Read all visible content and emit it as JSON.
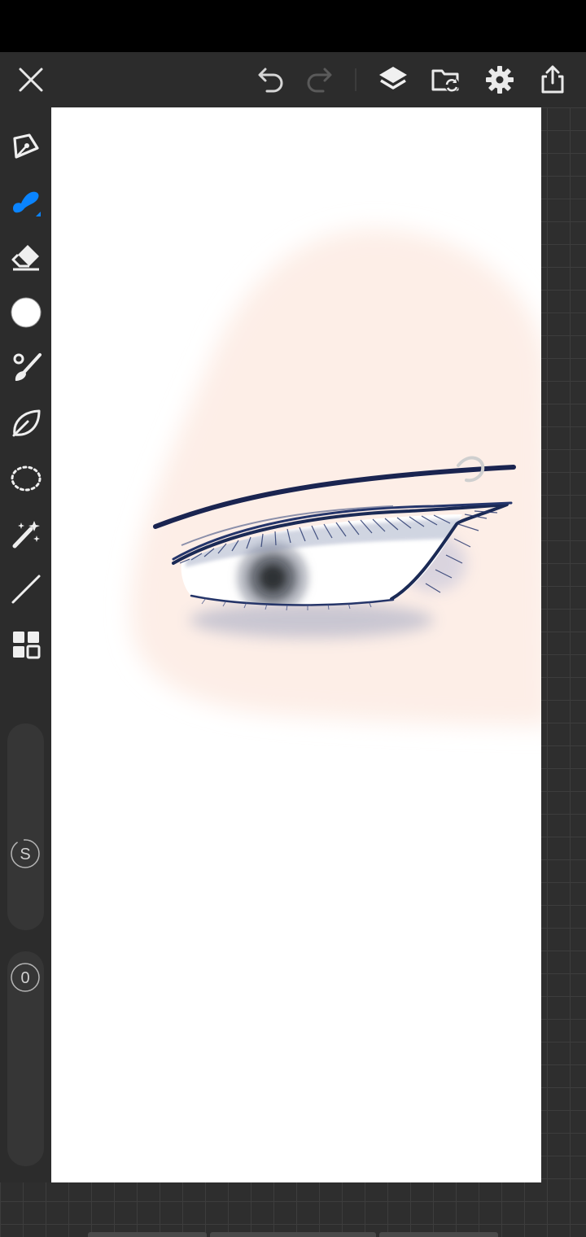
{
  "app": {
    "accent_color": "#0a84ff",
    "toolbar_bg": "#2c2c2c",
    "canvas_bg": "#ffffff"
  },
  "topbar": {
    "buttons": [
      {
        "name": "close",
        "icon": "close-icon"
      },
      {
        "name": "undo",
        "icon": "undo-icon"
      },
      {
        "name": "redo",
        "icon": "redo-icon",
        "disabled": true
      },
      {
        "name": "layers",
        "icon": "layers-icon"
      },
      {
        "name": "gallery",
        "icon": "folder-sync-icon"
      },
      {
        "name": "settings",
        "icon": "gear-icon"
      },
      {
        "name": "share",
        "icon": "share-icon"
      }
    ]
  },
  "sidebar": {
    "tools": [
      {
        "name": "pen",
        "icon": "pen-nib-icon"
      },
      {
        "name": "brush",
        "icon": "brush-icon",
        "selected": true
      },
      {
        "name": "eraser",
        "icon": "eraser-icon"
      },
      {
        "name": "color",
        "icon": "color-swatch-icon",
        "value": "#ffffff"
      },
      {
        "name": "smudge",
        "icon": "smudge-icon"
      },
      {
        "name": "lasso-fill",
        "icon": "leaf-icon"
      },
      {
        "name": "selection",
        "icon": "lasso-select-icon"
      },
      {
        "name": "magic-wand",
        "icon": "magic-wand-icon"
      },
      {
        "name": "line",
        "icon": "line-icon"
      },
      {
        "name": "more",
        "icon": "grid-icon"
      }
    ],
    "size_slider": {
      "label": "S"
    },
    "opacity_slider": {
      "label": "0"
    }
  },
  "canvas": {
    "artwork": "eye-drawing"
  }
}
